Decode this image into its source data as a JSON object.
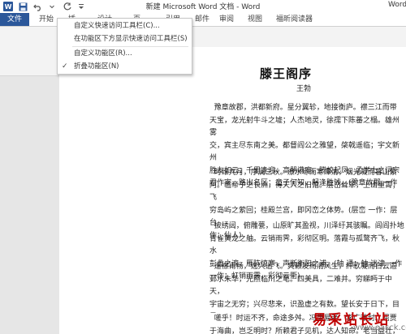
{
  "window": {
    "title": "新建 Microsoft Word 文档 - Word",
    "side_label": "Word"
  },
  "qat": {
    "logo_letter": "W"
  },
  "tabs": [
    {
      "label": "文件"
    },
    {
      "label": "开始"
    },
    {
      "label": "插"
    },
    {
      "label": "设计"
    },
    {
      "label": "页"
    },
    {
      "label": "引用"
    },
    {
      "label": "邮件"
    },
    {
      "label": "审阅"
    },
    {
      "label": "视图"
    },
    {
      "label": "福昕阅读器"
    }
  ],
  "menu": {
    "items": [
      {
        "label": "自定义快速访问工具栏(C)...",
        "checked": false
      },
      {
        "label": "在功能区下方显示快速访问工具栏(S)",
        "checked": false
      },
      {
        "label": "自定义功能区(R)...",
        "checked": false
      },
      {
        "label": "折叠功能区(N)",
        "checked": true
      }
    ]
  },
  "document": {
    "title": "滕王阁序",
    "author": "王勃",
    "paragraphs": [
      "  豫章故郡，洪都新府。星分翼轸，地接衡庐。襟三江而带\n天宝，龙光射牛斗之墟；人杰地灵，徐孺下陈蕃之榻。雄州雾\n交，宾主尽东南之美。都督阎公之雅望，棨戟遥临；宇文新州\n胜友如云；千里逢迎，高朋满座。腾蛟起凤，孟学士之词宗\n君作宰，路出名区；童子何知，躬逢胜饯。(豫章故郡 一作",
      "  时维九月，序属三秋。潦水尽而寒潭清，烟光凝而暮山紫\n阿。临帝子之长洲，得天人之旧馆。层峦耸翠，上出重霄；飞\n穷岛屿之萦回；桂殿兰宫，即冈峦之体势。(层峦 一作：层台\n作：仙人)",
      "  披绣闼，俯雕甍，山原旷其盈视，川泽纡其骇瞩。闾阎扑地\n青雀黄龙之舳。云销雨霁，彩彻区明。落霞与孤鹜齐飞，秋水\n彭蠡之滨，雁阵惊寒，声断衡阳之浦。(轴 通：舳 迷津 一作\n一作：虹销雨霁，彩彻云衢)",
      "  遥襟甫畅，逸兴遄飞。爽籁发而清风生，纤歌凝而白云遏\n邺水朱华，光照临川之笔。四美具，二难并。穷睇眄于中天，\n宇宙之无穷；兴尽悲来，识盈虚之有数。望长安于日下，目吴\n天柱高而北辰远。关山难越，谁悲失路之人；萍水相逢，尽是\n宣室以何年？(遥襟甫畅 一作：遥吟俯畅)",
      "  嗟乎！时运不齐，命途多舛。冯唐易老，李广难封。屈贾\n于海曲，岂乏明时？所赖君子见机，达人知命。老当益壮，宁\n青云之志。酌贪泉而觉爽，处涸辙以犹欢。北海虽赊，扶摇可"
    ]
  },
  "watermark": {
    "site_name": "易采站长站",
    "url": "www.easck.com"
  }
}
